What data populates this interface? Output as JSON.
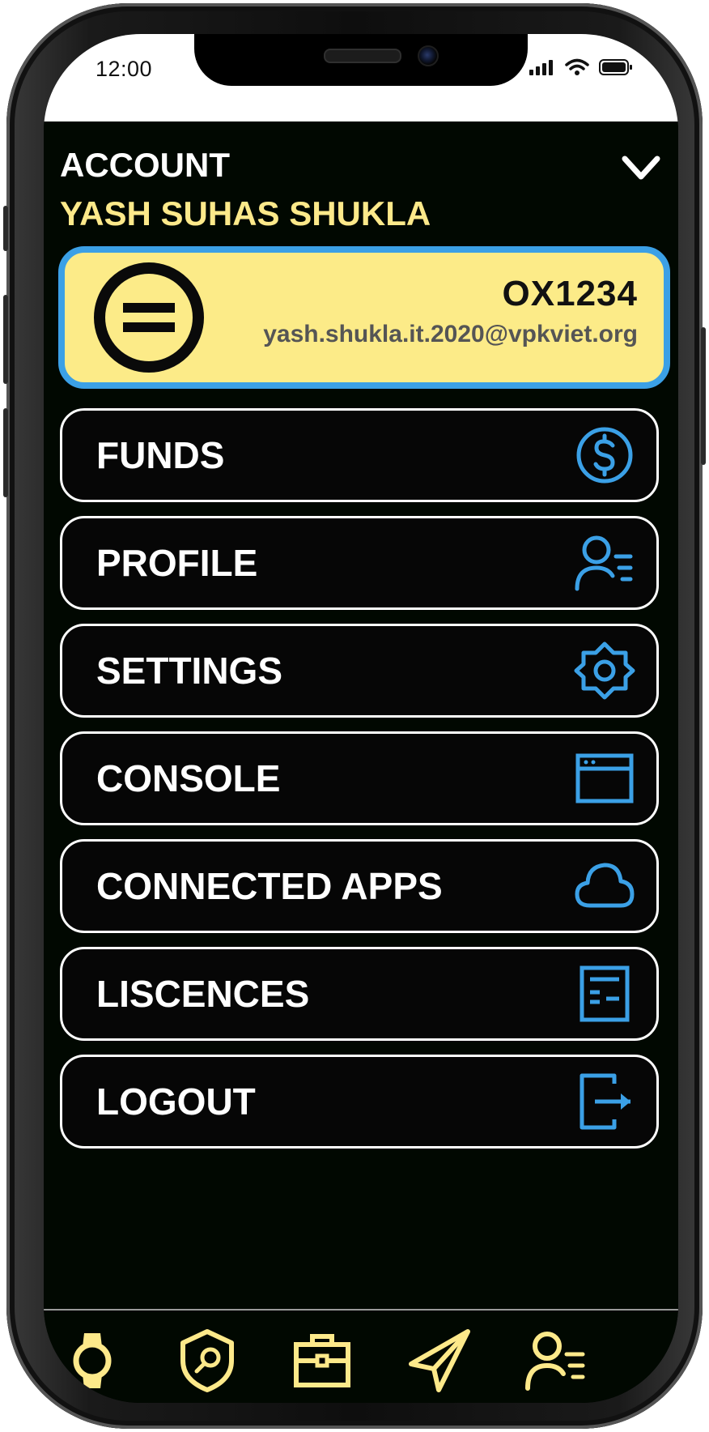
{
  "status_bar": {
    "time": "12:00",
    "icons": [
      "signal-icon",
      "wifi-icon",
      "battery-icon"
    ]
  },
  "header": {
    "title": "ACCOUNT",
    "user_name": "YASH SUHAS SHUKLA",
    "collapse_icon": "chevron-down-icon"
  },
  "account_card": {
    "logo_icon": "equals-circle-icon",
    "account_id": "OX1234",
    "email": "yash.shukla.it.2020@vpkviet.org"
  },
  "menu": {
    "items": [
      {
        "label": "FUNDS",
        "icon": "dollar-icon"
      },
      {
        "label": "PROFILE",
        "icon": "user-list-icon"
      },
      {
        "label": "SETTINGS",
        "icon": "gear-icon"
      },
      {
        "label": "CONSOLE",
        "icon": "window-icon"
      },
      {
        "label": "CONNECTED APPS",
        "icon": "cloud-icon"
      },
      {
        "label": "LISCENCES",
        "icon": "document-icon"
      },
      {
        "label": "LOGOUT",
        "icon": "logout-icon"
      }
    ]
  },
  "tab_bar": {
    "tabs": [
      {
        "icon": "watch-icon"
      },
      {
        "icon": "shield-search-icon"
      },
      {
        "icon": "briefcase-icon"
      },
      {
        "icon": "send-icon"
      },
      {
        "icon": "user-list-icon"
      }
    ]
  },
  "colors": {
    "background": "#010801",
    "accent_yellow": "#fceb88",
    "accent_blue": "#3ba0e6",
    "menu_border": "#ffffff",
    "tab_icon": "#fde98a"
  }
}
